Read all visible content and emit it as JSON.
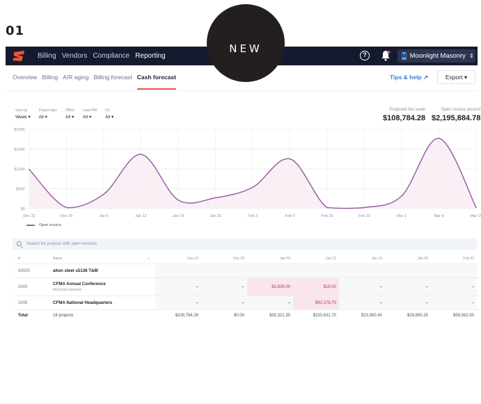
{
  "slide_number": "01",
  "badge": "NEW",
  "nav": {
    "items": [
      "Billing",
      "Vendors",
      "Compliance",
      "Reporting"
    ],
    "active": "Reporting",
    "org_initial": "M",
    "org_name": "Moonlight Masonry"
  },
  "subnav": {
    "tabs": [
      "Overview",
      "Billing",
      "A/R aging",
      "Billing forecast",
      "Cash forecast"
    ],
    "active": "Cash forecast",
    "tips_label": "Tips & help",
    "export_label": "Export"
  },
  "filters": [
    {
      "label": "View by",
      "value": "Week"
    },
    {
      "label": "Project type",
      "value": "All"
    },
    {
      "label": "Office",
      "value": "All"
    },
    {
      "label": "Lead PM",
      "value": "All"
    },
    {
      "label": "GC",
      "value": "All"
    }
  ],
  "metrics": {
    "projected_label": "Projected this week",
    "projected_value": "$108,784.28",
    "open_label": "Open invoice amount",
    "open_value": "$2,195,884.78"
  },
  "chart_data": {
    "type": "area",
    "categories": [
      "Dec 22",
      "Dec 29",
      "Jan 5",
      "Jan 12",
      "Jan 19",
      "Jan 26",
      "Feb 2",
      "Feb 9",
      "Feb 16",
      "Feb 23",
      "Mar 1",
      "Mar 8",
      "Mar 15"
    ],
    "y_tick_labels": [
      "$0",
      "$55K",
      "$110K",
      "$165K",
      "$220K"
    ],
    "ylim": [
      0,
      220000
    ],
    "series": [
      {
        "name": "Open invoice",
        "values": [
          108784,
          3000,
          40000,
          150632,
          23900,
          29890,
          59082,
          138000,
          3000,
          3000,
          35000,
          195000,
          3000
        ]
      }
    ],
    "color": "#9b5fa8",
    "grid": true,
    "legend_position": "bottom-left"
  },
  "search": {
    "placeholder": "Search for projects with open invoices"
  },
  "table": {
    "headers": [
      "#",
      "Name",
      "Dec 22",
      "Dec 29",
      "Jan 05",
      "Jan 12",
      "Jan 19",
      "Jan 26",
      "Feb 02"
    ],
    "rows": [
      {
        "num": "63025",
        "name": "alton steel s5136 T&M",
        "sub": "",
        "values": [
          "",
          "",
          "",
          "",
          "",
          "",
          ""
        ]
      },
      {
        "num": "2543",
        "name": "CFMA Annual Conference",
        "sub": "McCown Gordon",
        "values": [
          "–",
          "–",
          "$2,826.00",
          "$18.00",
          "–",
          "–",
          "–"
        ]
      },
      {
        "num": "2435",
        "name": "CFMA National Headquarters",
        "sub": "",
        "values": [
          "–",
          "–",
          "–",
          "$92,378.70",
          "–",
          "–",
          "–"
        ]
      }
    ],
    "total": {
      "label": "Total",
      "projects": "18 projects",
      "values": [
        "$108,784.28",
        "$0.00",
        "$35,321.30",
        "$150,631.70",
        "$23,900.40",
        "$29,890.25",
        "$59,082.50"
      ]
    }
  }
}
